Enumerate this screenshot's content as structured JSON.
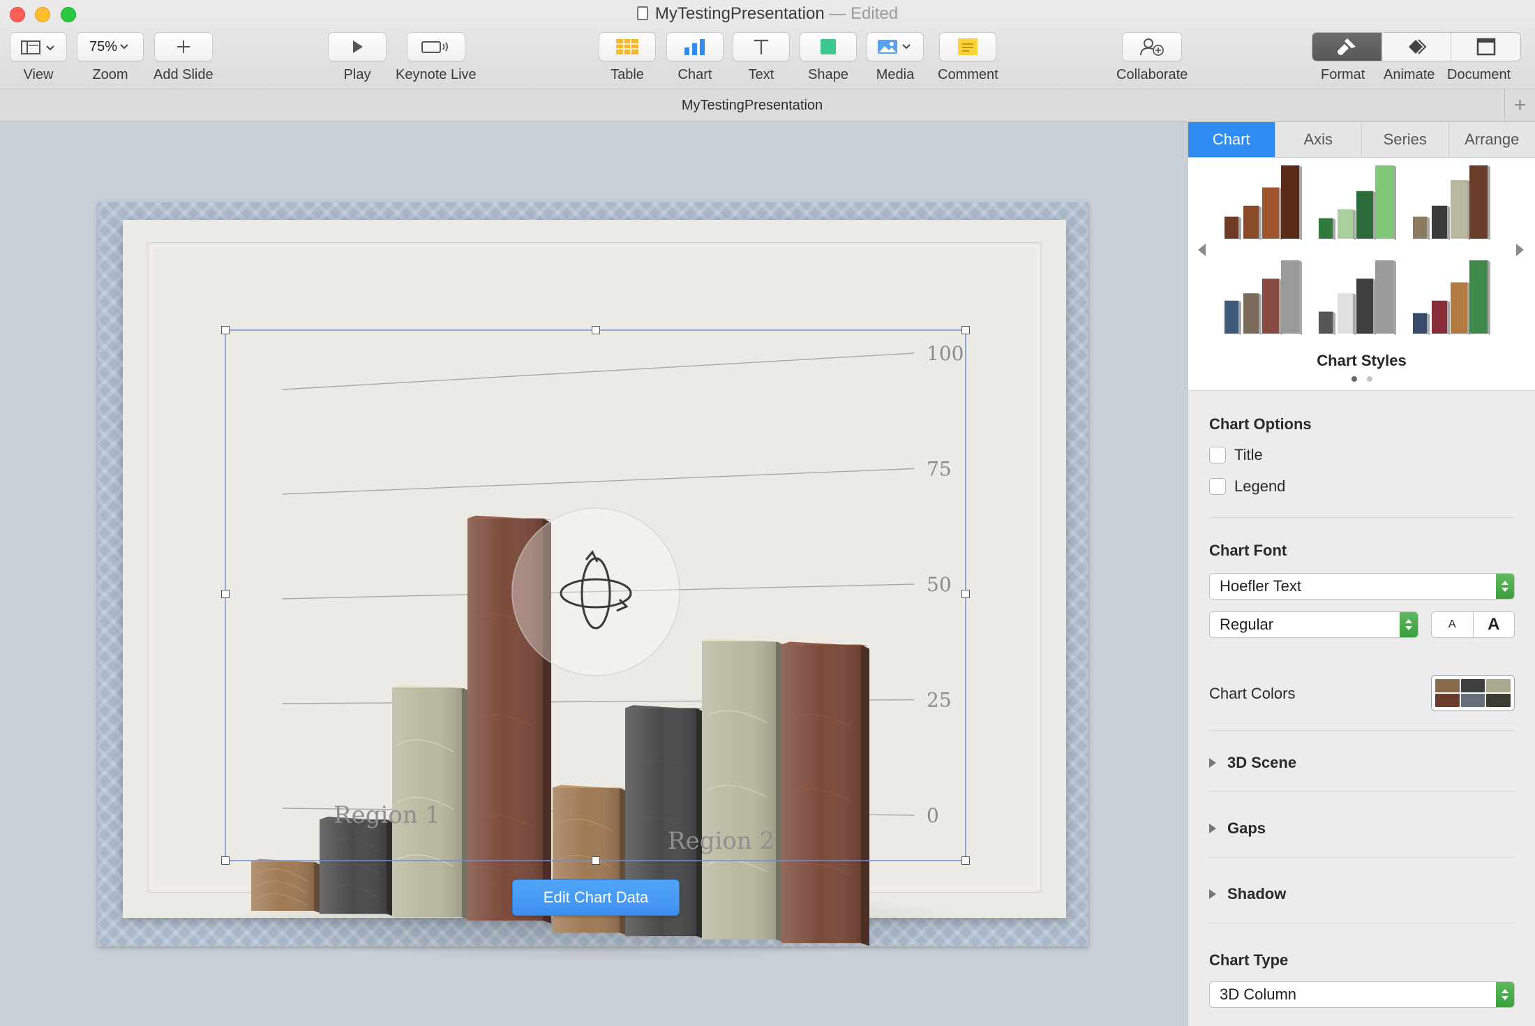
{
  "window": {
    "title": "MyTestingPresentation",
    "title_separator": " — ",
    "status": "Edited"
  },
  "toolbar": {
    "view": "View",
    "zoom_value": "75%",
    "zoom": "Zoom",
    "add_slide": "Add Slide",
    "play": "Play",
    "keynote_live": "Keynote Live",
    "table": "Table",
    "chart": "Chart",
    "text": "Text",
    "shape": "Shape",
    "media": "Media",
    "comment": "Comment",
    "collaborate": "Collaborate",
    "format": "Format",
    "animate": "Animate",
    "document": "Document"
  },
  "tabs": {
    "document_tab": "MyTestingPresentation",
    "add_tab": "+"
  },
  "slide": {
    "edit_chart_data": "Edit Chart Data"
  },
  "chart_data": {
    "type": "bar",
    "style": "3D Column",
    "categories": [
      "Region 1",
      "Region 2"
    ],
    "series": [
      {
        "values": [
          12,
          35
        ]
      },
      {
        "values": [
          23,
          55
        ]
      },
      {
        "values": [
          56,
          72
        ]
      },
      {
        "values": [
          98,
          72
        ]
      }
    ],
    "yticks": [
      "0",
      "25",
      "50",
      "75",
      "100"
    ],
    "ylim": [
      0,
      100
    ],
    "grid": true,
    "legend": "none",
    "title": "",
    "series_colors": [
      "#a07a55",
      "#4a4a4a",
      "#b9b8a0",
      "#7b4a3a"
    ]
  },
  "inspector": {
    "tabs": [
      "Chart",
      "Axis",
      "Series",
      "Arrange"
    ],
    "chart_styles_title": "Chart Styles",
    "chart_options_title": "Chart Options",
    "option_title": "Title",
    "option_legend": "Legend",
    "chart_font_title": "Chart Font",
    "font_family": "Hoefler Text",
    "font_style": "Regular",
    "size_small": "A",
    "size_large": "A",
    "chart_colors_label": "Chart Colors",
    "scene_3d": "3D Scene",
    "gaps": "Gaps",
    "shadow": "Shadow",
    "chart_type_title": "Chart Type",
    "chart_type_value": "3D Column"
  }
}
